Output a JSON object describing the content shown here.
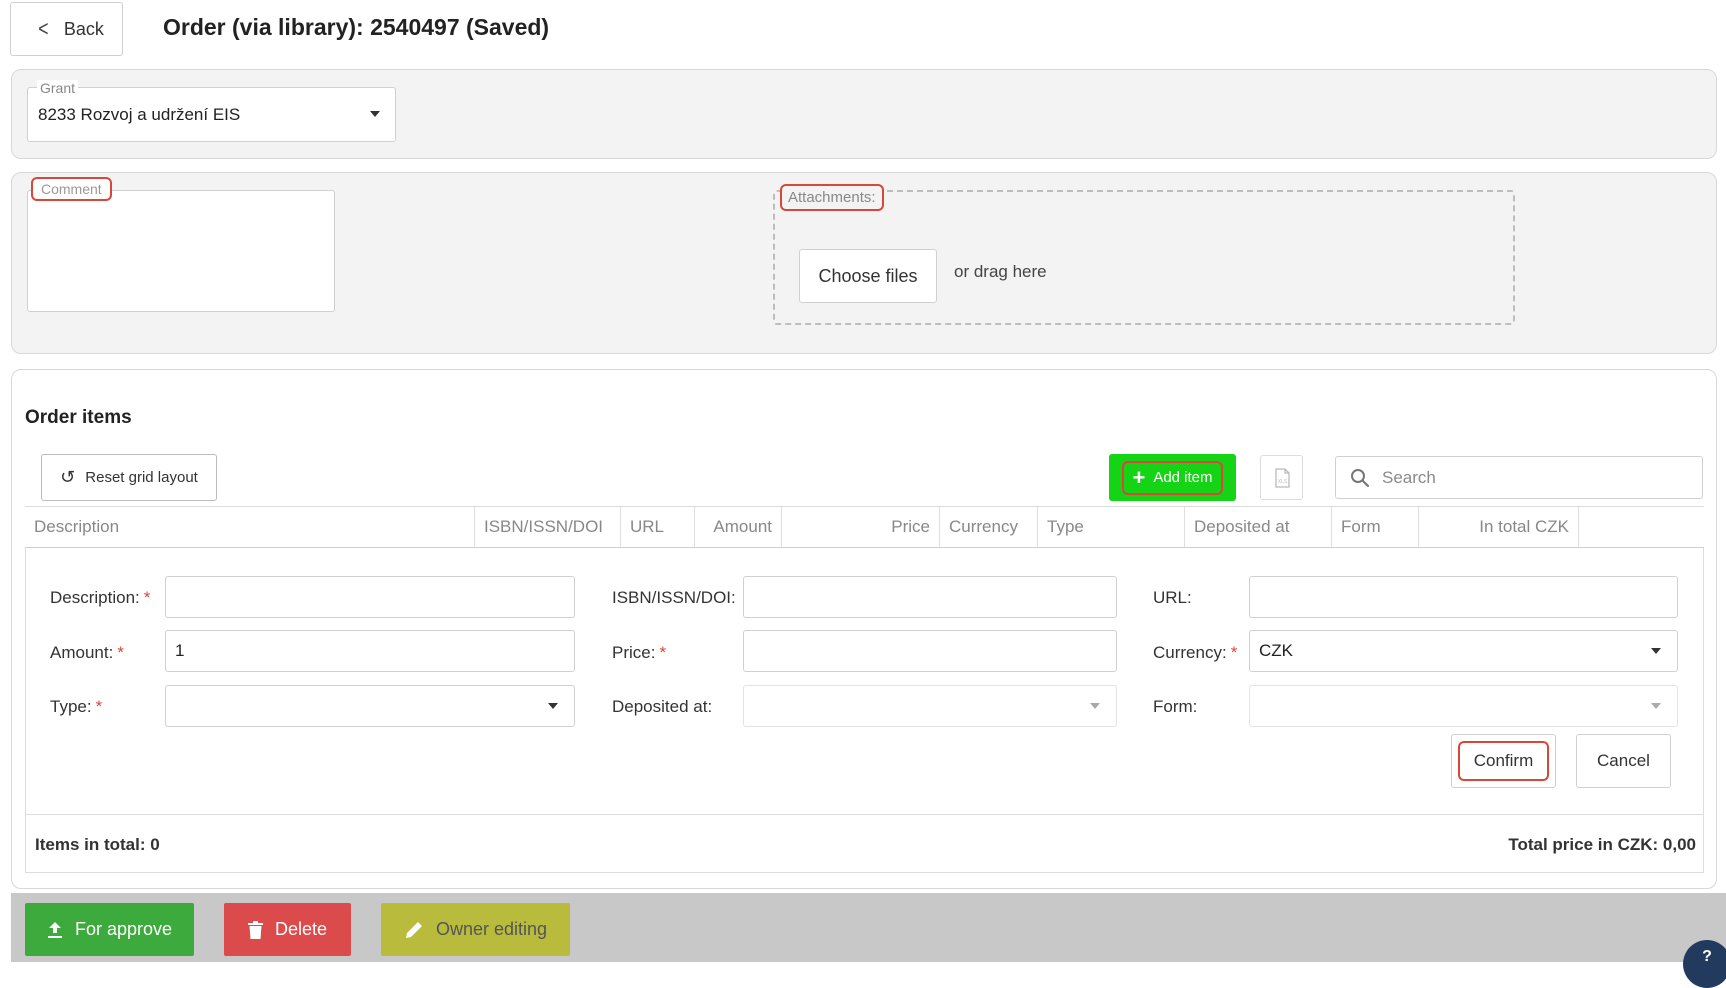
{
  "header": {
    "back_label": "Back",
    "title": "Order (via library): 2540497 (Saved)"
  },
  "grant": {
    "legend": "Grant",
    "value": "8233 Rozvoj a udržení EIS"
  },
  "comment": {
    "legend": "Comment"
  },
  "attachments": {
    "legend": "Attachments:",
    "choose_label": "Choose files",
    "drag_text": "or drag here"
  },
  "order_items": {
    "title": "Order items",
    "reset_label": "Reset grid layout",
    "add_label": "Add item",
    "export_icon_text": "XLS",
    "search_placeholder": "Search",
    "columns": [
      "Description",
      "ISBN/ISSN/DOI",
      "URL",
      "Amount",
      "Price",
      "Currency",
      "Type",
      "Deposited at",
      "Form",
      "In total CZK"
    ]
  },
  "form": {
    "description_label": "Description:",
    "isbn_label": "ISBN/ISSN/DOI:",
    "url_label": "URL:",
    "amount_label": "Amount:",
    "amount_value": "1",
    "price_label": "Price:",
    "currency_label": "Currency:",
    "currency_value": "CZK",
    "type_label": "Type:",
    "deposited_label": "Deposited at:",
    "form_label": "Form:",
    "required_mark": "*",
    "confirm_label": "Confirm",
    "cancel_label": "Cancel"
  },
  "summary": {
    "items_total": "Items in total: 0",
    "total_price": "Total price in CZK: 0,00"
  },
  "actions": {
    "approve_label": "For approve",
    "delete_label": "Delete",
    "owner_label": "Owner editing"
  },
  "help": {
    "label": "?"
  },
  "colors": {
    "accent_green": "#15d415",
    "approve": "#3daa3d",
    "delete": "#dc4b4b",
    "owner": "#b8bb3c",
    "highlight": "#d9463a"
  }
}
